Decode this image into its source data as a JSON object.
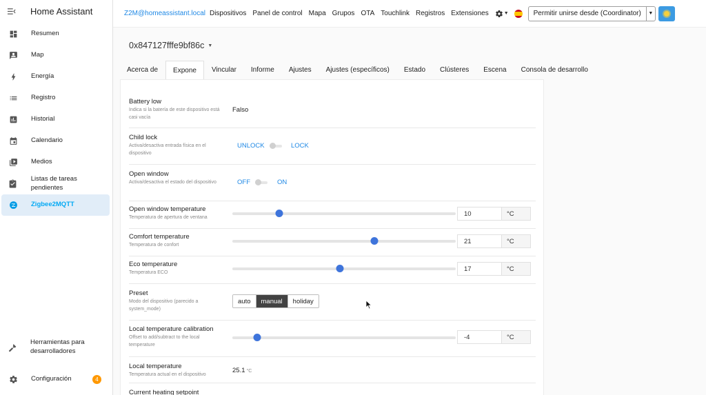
{
  "app": {
    "title": "Home Assistant"
  },
  "sidebar": {
    "items": [
      {
        "label": "Resumen",
        "icon": "dashboard-icon"
      },
      {
        "label": "Map",
        "icon": "map-icon"
      },
      {
        "label": "Energía",
        "icon": "lightning-icon"
      },
      {
        "label": "Registro",
        "icon": "list-icon"
      },
      {
        "label": "Historial",
        "icon": "chart-icon"
      },
      {
        "label": "Calendario",
        "icon": "calendar-icon"
      },
      {
        "label": "Medios",
        "icon": "media-icon"
      },
      {
        "label": "Listas de tareas pendientes",
        "icon": "clipboard-icon"
      },
      {
        "label": "Zigbee2MQTT",
        "icon": "zigbee-icon",
        "active": true
      }
    ],
    "bottom": {
      "dev_tools": "Herramientas para desarrolladores",
      "settings": "Configuración",
      "settings_badge": "4"
    }
  },
  "topbar": {
    "brand": "Z2M@homeassistant.local",
    "links": [
      "Dispositivos",
      "Panel de control",
      "Mapa",
      "Grupos",
      "OTA",
      "Touchlink",
      "Registros",
      "Extensiones"
    ],
    "permit_label": "Permitir unirse desde (Coordinator)"
  },
  "device": {
    "id": "0x847127fffe9bf86c"
  },
  "tabs": [
    "Acerca de",
    "Expone",
    "Vincular",
    "Informe",
    "Ajustes",
    "Ajustes (específicos)",
    "Estado",
    "Clústeres",
    "Escena",
    "Consola de desarrollo"
  ],
  "active_tab": "Expone",
  "exposes": {
    "battery_low": {
      "name": "Battery low",
      "desc": "Indica si la batería de este dispositivo está casi vacía",
      "value": "Falso"
    },
    "child_lock": {
      "name": "Child lock",
      "desc": "Activa/desactiva entrada física en el dispositivo",
      "off": "UNLOCK",
      "on": "LOCK"
    },
    "open_window": {
      "name": "Open window",
      "desc": "Activa/desactiva el estado del dispositivo",
      "off": "OFF",
      "on": "ON"
    },
    "open_window_temperature": {
      "name": "Open window temperature",
      "desc": "Temperatura de apertura de ventana",
      "value": "10",
      "unit": "°C",
      "fraction": 0.21
    },
    "comfort_temperature": {
      "name": "Comfort temperature",
      "desc": "Temperatura de confort",
      "value": "21",
      "unit": "°C",
      "fraction": 0.635
    },
    "eco_temperature": {
      "name": "Eco temperature",
      "desc": "Temperatura ECO",
      "value": "17",
      "unit": "°C",
      "fraction": 0.48
    },
    "preset": {
      "name": "Preset",
      "desc": "Modo del dispositivo (parecido a system_mode)",
      "options": [
        "auto",
        "manual",
        "holiday"
      ],
      "selected": "manual"
    },
    "local_temperature_calibration": {
      "name": "Local temperature calibration",
      "desc": "Offset to add/subtract to the local temperature",
      "value": "-4",
      "unit": "°C",
      "fraction": 0.11
    },
    "local_temperature": {
      "name": "Local temperature",
      "desc": "Temperatura actual en el dispositivo",
      "value": "25.1",
      "unit": "°C"
    },
    "current_heating_setpoint": {
      "name": "Current heating setpoint"
    }
  }
}
